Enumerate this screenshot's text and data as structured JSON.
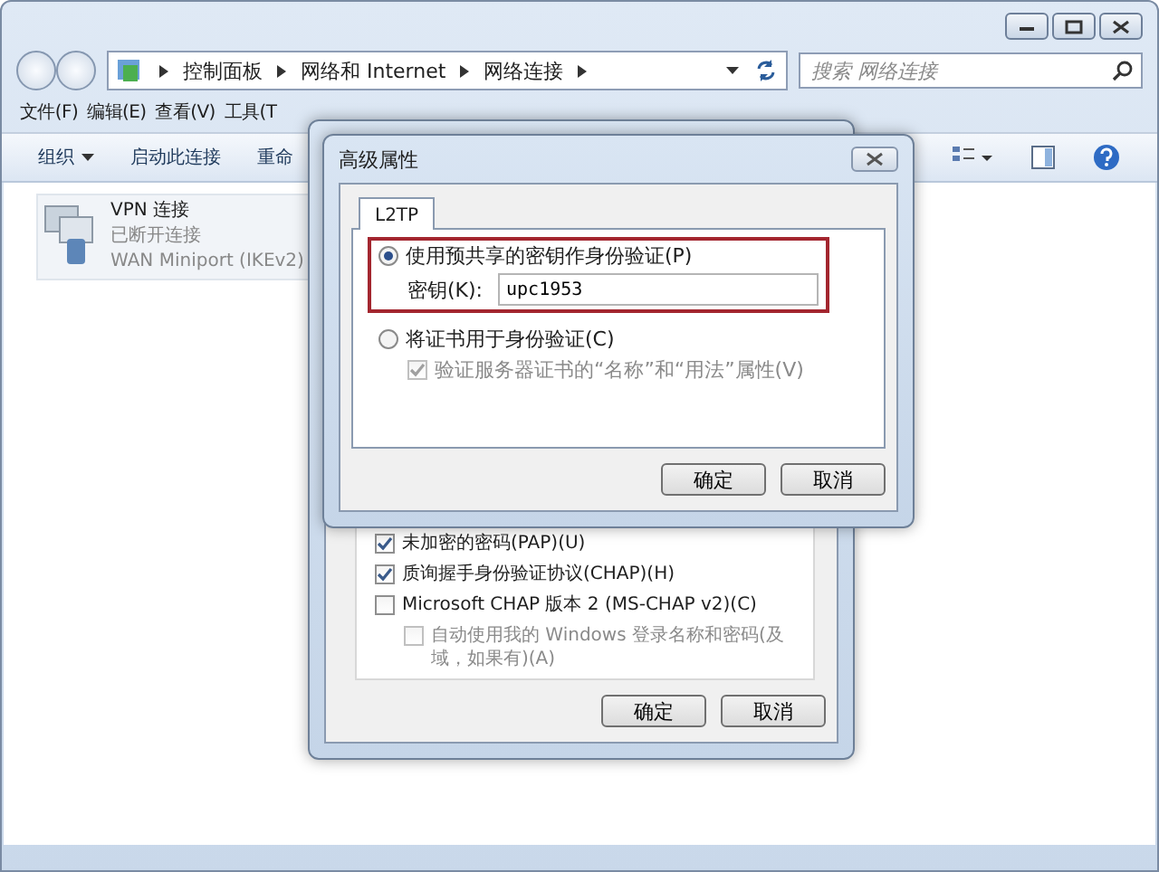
{
  "explorer": {
    "breadcrumb": [
      "控制面板",
      "网络和 Internet",
      "网络连接"
    ],
    "search": {
      "placeholder": "搜索 网络连接"
    },
    "menu": [
      "文件(F)",
      "编辑(E)",
      "查看(V)",
      "工具(T"
    ],
    "toolbar": [
      {
        "label": "组织",
        "dropdown": true
      },
      {
        "label": "启动此连接",
        "dropdown": false
      },
      {
        "label": "重命",
        "dropdown": false
      }
    ],
    "connections": [
      {
        "name": "VPN 连接",
        "status": "已断开连接",
        "device": "WAN Miniport (IKEv2)"
      }
    ]
  },
  "back_dialog": {
    "auth_options": [
      {
        "label": "未加密的密码(PAP)(U)",
        "checked": true,
        "disabled": false
      },
      {
        "label": "质询握手身份验证协议(CHAP)(H)",
        "checked": true,
        "disabled": false
      },
      {
        "label": "Microsoft CHAP 版本 2 (MS-CHAP v2)(C)",
        "checked": false,
        "disabled": false,
        "children": [
          {
            "label": "自动使用我的 Windows 登录名称和密码(及域，如果有)(A)",
            "checked": false,
            "disabled": true
          }
        ]
      }
    ],
    "buttons": [
      "确定",
      "取消"
    ]
  },
  "front_dialog": {
    "title": "高级属性",
    "tabs": [
      {
        "label": "L2TP",
        "selected": true
      }
    ],
    "options": [
      {
        "label": "使用预共享的密钥作身份验证(P)",
        "selected": true,
        "highlighted": true,
        "key_field": {
          "label": "密钥(K):",
          "value": "upc1953"
        }
      },
      {
        "label": "将证书用于身份验证(C)",
        "selected": false,
        "highlighted": false,
        "children": [
          {
            "label": "验证服务器证书的“名称”和“用法”属性(V)",
            "checked": true,
            "disabled": true
          }
        ]
      }
    ],
    "buttons": [
      "确定",
      "取消"
    ]
  }
}
